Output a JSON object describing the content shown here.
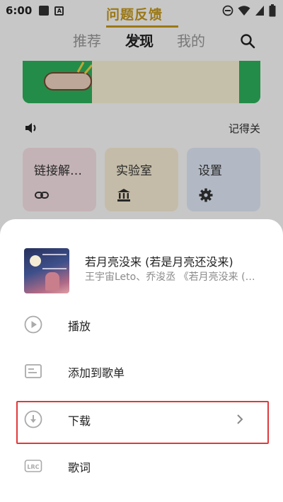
{
  "status_bar": {
    "time": "6:00",
    "notification_letter": "A"
  },
  "nav": {
    "tabs": [
      "推荐",
      "发现",
      "我的"
    ],
    "active_tab": "发现"
  },
  "banner": {
    "text": "问题反馈"
  },
  "volume_row": {
    "remember_label": "记得关"
  },
  "cards": [
    {
      "label": "链接解…",
      "icon": "link-icon"
    },
    {
      "label": "实验室",
      "icon": "bank-icon"
    },
    {
      "label": "设置",
      "icon": "gear-icon"
    }
  ],
  "sheet": {
    "song": {
      "title": "若月亮没来 (若是月亮还没来)",
      "subtitle": "王宇宙Leto、乔浚丞 《若月亮没来 (…"
    },
    "menu": [
      {
        "label": "播放",
        "icon": "play-circle-icon"
      },
      {
        "label": "添加到歌单",
        "icon": "playlist-add-icon"
      },
      {
        "label": "下载",
        "icon": "download-icon"
      },
      {
        "label": "歌词",
        "icon": "lyrics-icon"
      }
    ]
  },
  "colors": {
    "highlight": "#e0383a",
    "banner_green": "#2fb45e",
    "banner_gold": "#c79a1d"
  }
}
